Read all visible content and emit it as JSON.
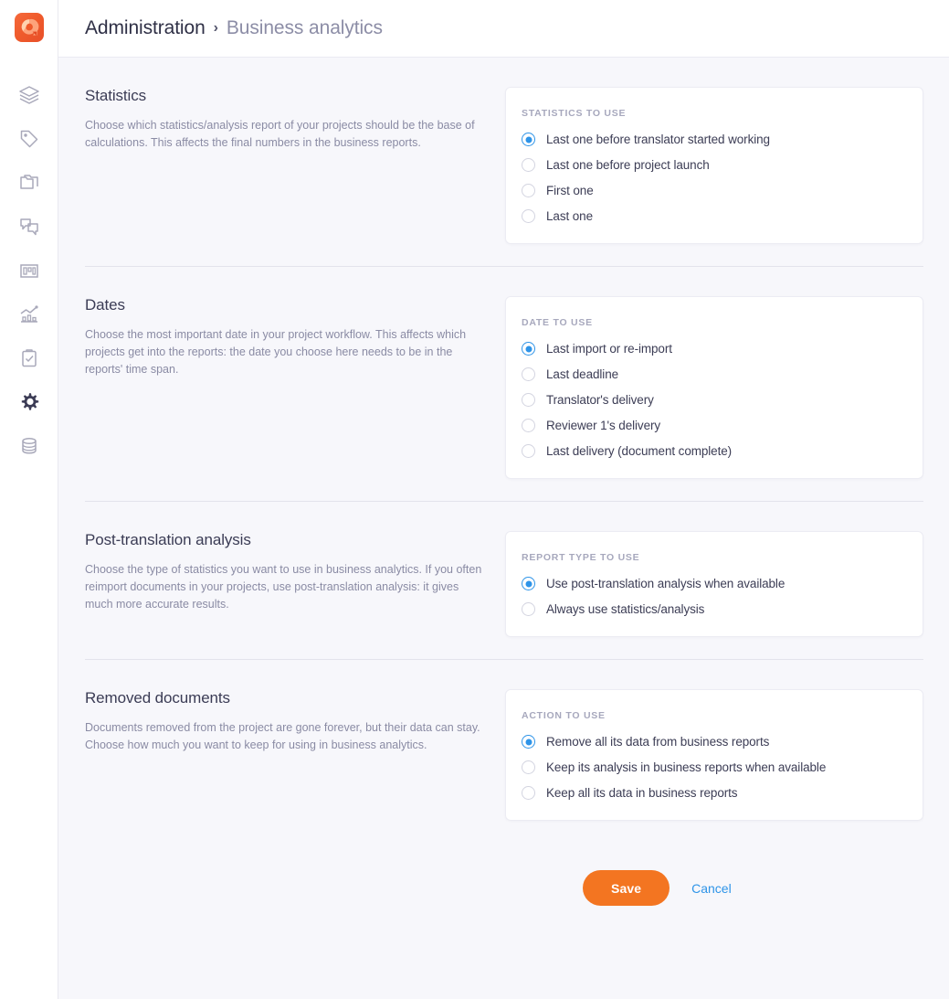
{
  "app": {
    "logo_name": "memoq-logo"
  },
  "breadcrumb": {
    "root": "Administration",
    "separator": "›",
    "leaf": "Business analytics"
  },
  "sidebar": {
    "items": [
      {
        "icon": "layers-icon",
        "label": "Layers",
        "active": false
      },
      {
        "icon": "tag-icon",
        "label": "Tags",
        "active": false
      },
      {
        "icon": "folders-icon",
        "label": "Projects",
        "active": false
      },
      {
        "icon": "chat-bubbles-icon",
        "label": "Communication",
        "active": false
      },
      {
        "icon": "bar-chart-icon",
        "label": "Resources",
        "active": false
      },
      {
        "icon": "analytics-icon",
        "label": "Business analytics",
        "active": false
      },
      {
        "icon": "clipboard-check-icon",
        "label": "Tasks",
        "active": false
      },
      {
        "icon": "gear-icon",
        "label": "Administration",
        "active": true
      },
      {
        "icon": "database-icon",
        "label": "Storage",
        "active": false
      }
    ]
  },
  "sections": [
    {
      "title": "Statistics",
      "description": "Choose which statistics/analysis report of your projects should be the base of calculations. This affects the final numbers in the business reports.",
      "panel_label": "STATISTICS TO USE",
      "options": [
        {
          "label": "Last one before translator started working",
          "checked": true
        },
        {
          "label": "Last one before project launch",
          "checked": false
        },
        {
          "label": "First one",
          "checked": false
        },
        {
          "label": "Last one",
          "checked": false
        }
      ]
    },
    {
      "title": "Dates",
      "description": "Choose the most important date in your project workflow. This affects which projects get into the reports: the date you choose here needs to be in the reports' time span.",
      "panel_label": "DATE TO USE",
      "options": [
        {
          "label": "Last import or re-import",
          "checked": true
        },
        {
          "label": "Last deadline",
          "checked": false
        },
        {
          "label": "Translator's delivery",
          "checked": false
        },
        {
          "label": "Reviewer 1's delivery",
          "checked": false
        },
        {
          "label": "Last delivery (document complete)",
          "checked": false
        }
      ]
    },
    {
      "title": "Post-translation analysis",
      "description": "Choose the type of statistics you want to use in business analytics. If you often reimport documents in your projects, use post-translation analysis: it gives much more accurate results.",
      "panel_label": "REPORT TYPE TO USE",
      "options": [
        {
          "label": "Use post-translation analysis when available",
          "checked": true
        },
        {
          "label": "Always use statistics/analysis",
          "checked": false
        }
      ]
    },
    {
      "title": "Removed documents",
      "description": "Documents removed from the project are gone forever, but their data can stay. Choose how much you want to keep for using in business analytics.",
      "panel_label": "ACTION TO USE",
      "options": [
        {
          "label": "Remove all its data from business reports",
          "checked": true
        },
        {
          "label": "Keep its analysis in business reports when available",
          "checked": false
        },
        {
          "label": "Keep all its data in business reports",
          "checked": false
        }
      ]
    }
  ],
  "footer": {
    "save_label": "Save",
    "cancel_label": "Cancel"
  },
  "colors": {
    "accent_orange": "#f37521",
    "accent_blue": "#2e94e8",
    "page_bg": "#f7f7fb",
    "panel_bg": "#ffffff",
    "text_dark": "#3c3d55",
    "text_muted": "#8a8ba4"
  }
}
